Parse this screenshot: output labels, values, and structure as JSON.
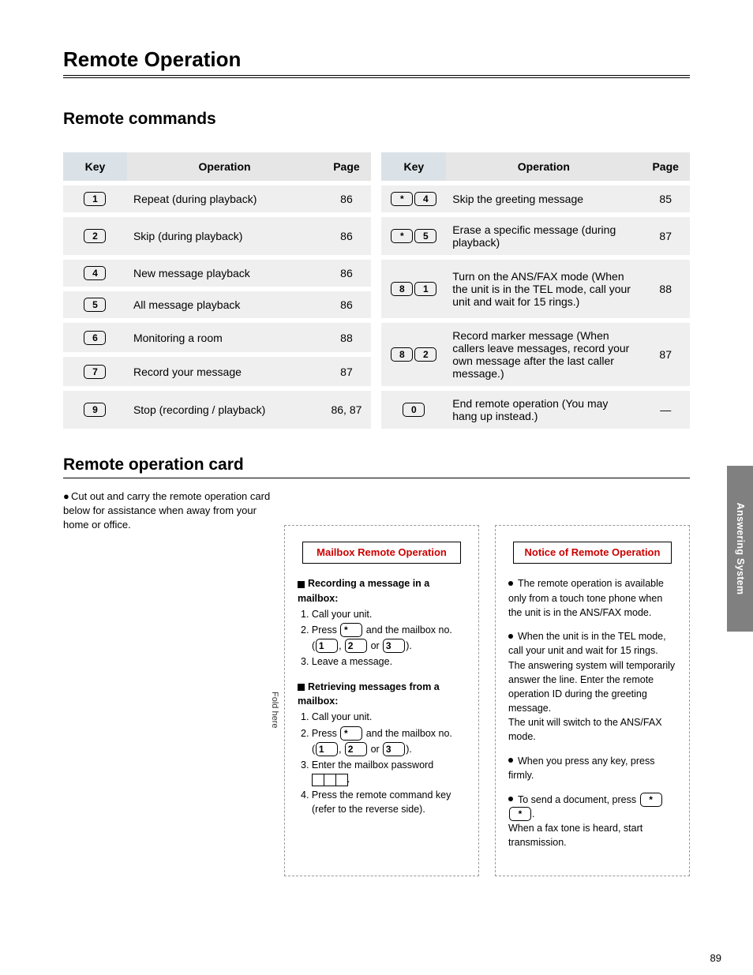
{
  "page": {
    "topTitle": "Remote Operation",
    "commandsTitle": "Remote commands",
    "header": {
      "key": "Key",
      "operation": "Operation",
      "page": "Page"
    },
    "leftRows": [
      {
        "keys": [
          "1"
        ],
        "op": "Repeat (during playback)",
        "page": "86"
      },
      {
        "keys": [
          "2"
        ],
        "op": "Skip (during playback)",
        "page": "86"
      },
      {
        "keys": [
          "4"
        ],
        "op": "New message playback",
        "page": "86"
      },
      {
        "keys": [
          "5"
        ],
        "op": "All message playback",
        "page": "86"
      },
      {
        "keys": [
          "6"
        ],
        "op": "Monitoring a room",
        "page": "88"
      },
      {
        "keys": [
          "7"
        ],
        "op": "Record your message",
        "page": "87"
      },
      {
        "keys": [
          "9"
        ],
        "op": "Stop (recording / playback)",
        "page": "86, 87"
      }
    ],
    "rightRows": [
      {
        "keys": [
          "*",
          "4"
        ],
        "op": "Skip the greeting message",
        "page": "85"
      },
      {
        "keys": [
          "*",
          "5"
        ],
        "op": "Erase a specific message (during playback)",
        "page": "87"
      },
      {
        "keys": [
          "8",
          "1"
        ],
        "op": "Turn on the ANS/FAX mode\n(When the unit is in the TEL mode, call your unit and wait for 15 rings.)",
        "page": "88"
      },
      {
        "keys": [
          "8",
          "2"
        ],
        "op": "Record marker message\n(When callers leave messages, record your own message after the last caller message.)",
        "page": "87"
      },
      {
        "keys": [
          "0"
        ],
        "op": "End remote operation\n(You may hang up instead.)",
        "page": "—"
      }
    ],
    "cardTitle": "Remote operation card",
    "cardNote": "Cut out and carry the remote operation card below for assistance when away from your home or office.",
    "mailbox": {
      "title": "Mailbox Remote Operation",
      "rec": {
        "h": "Recording a message in a mailbox:",
        "l1": "1.  Call your unit.",
        "l2a": "2.  Press ",
        "l2b": " and the mailbox no.",
        "l2c": "(",
        "l2d": ", ",
        "l2e": " or ",
        "l2f": ").",
        "l3": "3.  Leave a message."
      },
      "ret": {
        "h": "Retrieving messages from a mailbox:",
        "l1": "1.  Call your unit.",
        "l2a": "2.  Press ",
        "l2b": " and the mailbox no.",
        "l2c": "(",
        "l2d": ", ",
        "l2e": " or ",
        "l2f": ").",
        "l3": "3.  Enter the mailbox password",
        "l4": "4.  Press the remote command key (refer to the reverse side)."
      }
    },
    "notice": {
      "title": "Notice of Remote Operation",
      "b1": "The remote operation is available only from a touch tone phone when the unit is in the ANS/FAX mode.",
      "b2": "When the unit is in the TEL mode, call your unit and wait for 15 rings. The answering system will temporarily answer the line. Enter the remote operation ID during the greeting message.",
      "b2x": "The unit will switch to the ANS/FAX mode.",
      "b3": "When you press any key, press firmly.",
      "b4a": "To send a document, press ",
      "b4b": ".",
      "b4c": "When a fax tone is heard, start transmission."
    },
    "fold": "Fold here",
    "sideTab": "Answering System",
    "pageNumber": "89"
  }
}
